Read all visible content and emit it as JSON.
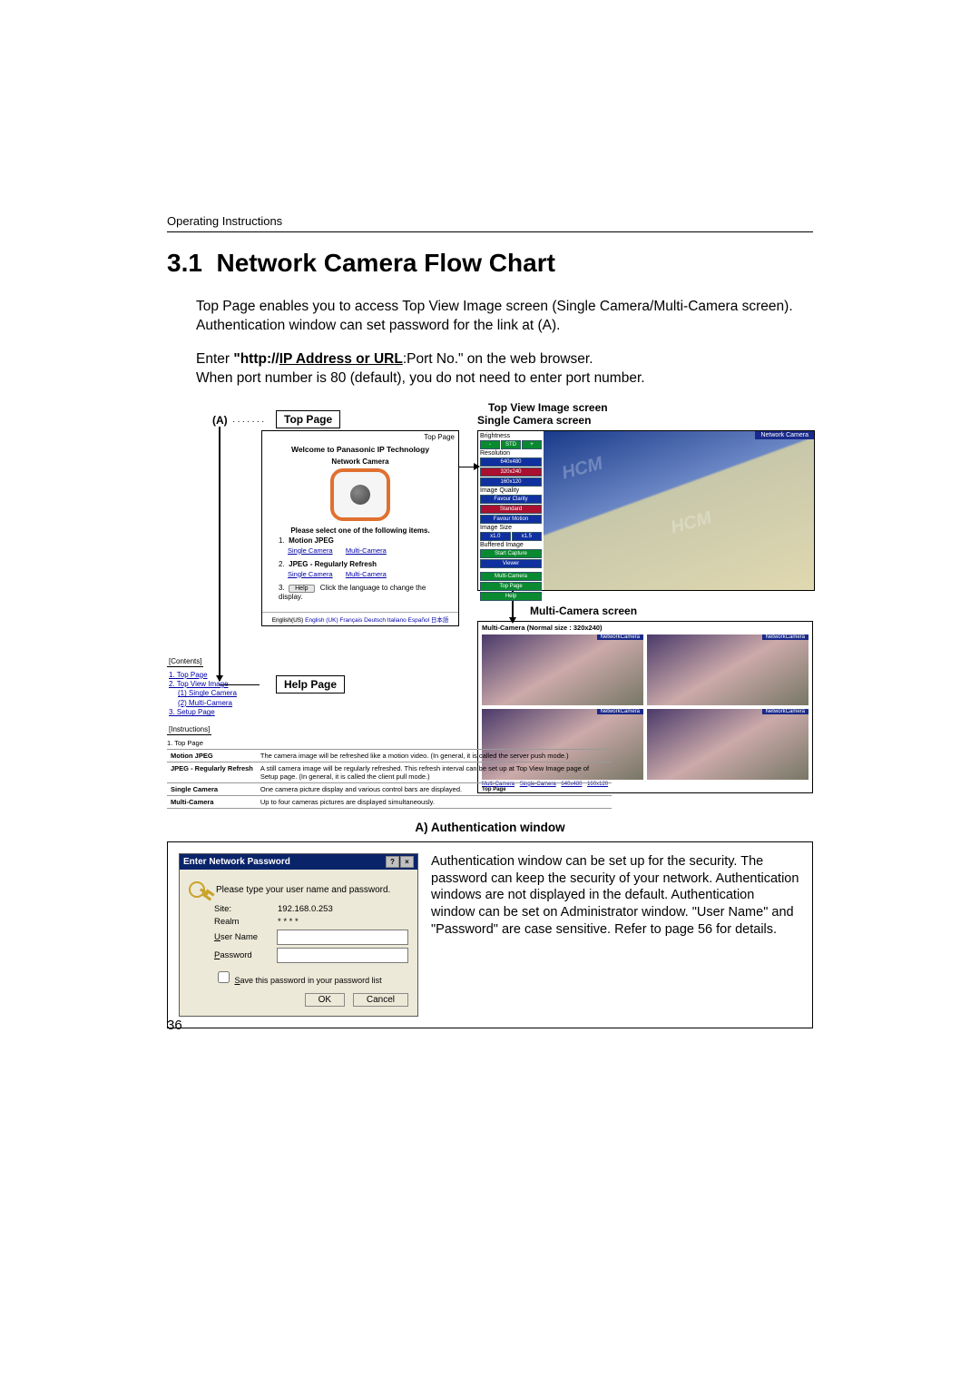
{
  "running_head": "Operating Instructions",
  "section_number": "3.1",
  "section_title": "Network Camera Flow Chart",
  "intro_para": "Top Page enables you to access Top View Image screen (Single Camera/Multi-Camera screen). Authentication window can set password for the link at (A).",
  "enter_line_prefix": "Enter ",
  "enter_line_bold": "\"http://IP Address or URL",
  "enter_line_suffix": ":Port No.\" on the web browser.",
  "port_note": "When port number is 80 (default), you do not need to enter port number.",
  "a_marker": "(A)",
  "labels": {
    "top_page": "Top Page",
    "top_view": "Top View Image screen",
    "single_cam": "Single Camera screen",
    "multi_cam": "Multi-Camera screen",
    "help_page": "Help Page"
  },
  "top_page": {
    "title_small": "Top Page",
    "welcome": "Welcome to Panasonic IP Technology",
    "cam_label": "Network Camera",
    "instruction": "Please select one of the following items.",
    "item1_head": "Motion JPEG",
    "link_single": "Single Camera",
    "link_multi": "Multi-Camera",
    "item2_head": "JPEG - Regularly Refresh",
    "help_btn": "Help",
    "help_note": "Click the language to change the display.",
    "lang_bar_selected": "English(US)",
    "lang_bar_rest": "English (UK)  Français  Deutsch  Italiano  Español  日本語"
  },
  "single_camera": {
    "network_camera_tag": "Network Camera",
    "brightness_label": "Brightness",
    "brightness_btns": [
      "-",
      "STD",
      "+"
    ],
    "resolution_label": "Resolution",
    "resolution_opts": [
      "640x480",
      "320x240",
      "160x120"
    ],
    "quality_label": "Image Quality",
    "quality_opts": [
      "Favour Clarity",
      "Standard",
      "Favour Motion"
    ],
    "size_label": "Image Size",
    "size_opts": [
      "x1.0",
      "x1.5"
    ],
    "buffered_label": "Buffered Image",
    "buffered_opts": [
      "Start Capture",
      "Viewer"
    ],
    "nav": [
      "Multi-Camera",
      "Top Page",
      "Help"
    ]
  },
  "multi_camera": {
    "head": "Multi-Camera (Normal size : 320x240)",
    "tag": "NetworkCamera",
    "footer_links": [
      "Multi-Camera",
      "Single-Camera",
      "640x480",
      "160x120"
    ],
    "footer_top": "Top Page"
  },
  "help": {
    "contents_label": "[Contents]",
    "links": [
      "1. Top Page",
      "2. Top View Image",
      "(1) Single Camera",
      "(2) Multi-Camera",
      "3. Setup Page"
    ],
    "instructions_label": "[Instructions]",
    "instr_head": "1. Top Page",
    "table": [
      [
        "Motion JPEG",
        "The camera image will be refreshed like a motion video.\n(In general, it is called the server push mode.)"
      ],
      [
        "JPEG - Regularly Refresh",
        "A still camera image will be regularly refreshed. This refresh interval can be set up at Top View Image page of Setup page.\n(In general, it is called the client pull mode.)"
      ],
      [
        "Single Camera",
        "One camera picture display and various control bars are displayed."
      ],
      [
        "Multi-Camera",
        "Up to four cameras pictures are displayed simultaneously."
      ]
    ]
  },
  "auth": {
    "heading": "A) Authentication window",
    "title": "Enter Network Password",
    "prompt": "Please type your user name and password.",
    "site_label": "Site:",
    "site_value": "192.168.0.253",
    "realm_label": "Realm",
    "realm_value": "* * * *",
    "user_label_u": "U",
    "user_label_rest": "ser Name",
    "pass_label_u": "P",
    "pass_label_rest": "assword",
    "save_checkbox_u": "S",
    "save_checkbox_rest": "ave this password in your password list",
    "ok": "OK",
    "cancel": "Cancel",
    "description": "Authentication window can be set up for the security. The password can keep the security of your network. Authentication windows are not displayed in the default. Authentication window can be set on Administrator window. \"User Name\" and \"Password\" are case sensitive. Refer to page 56 for details."
  },
  "page_number": "36"
}
